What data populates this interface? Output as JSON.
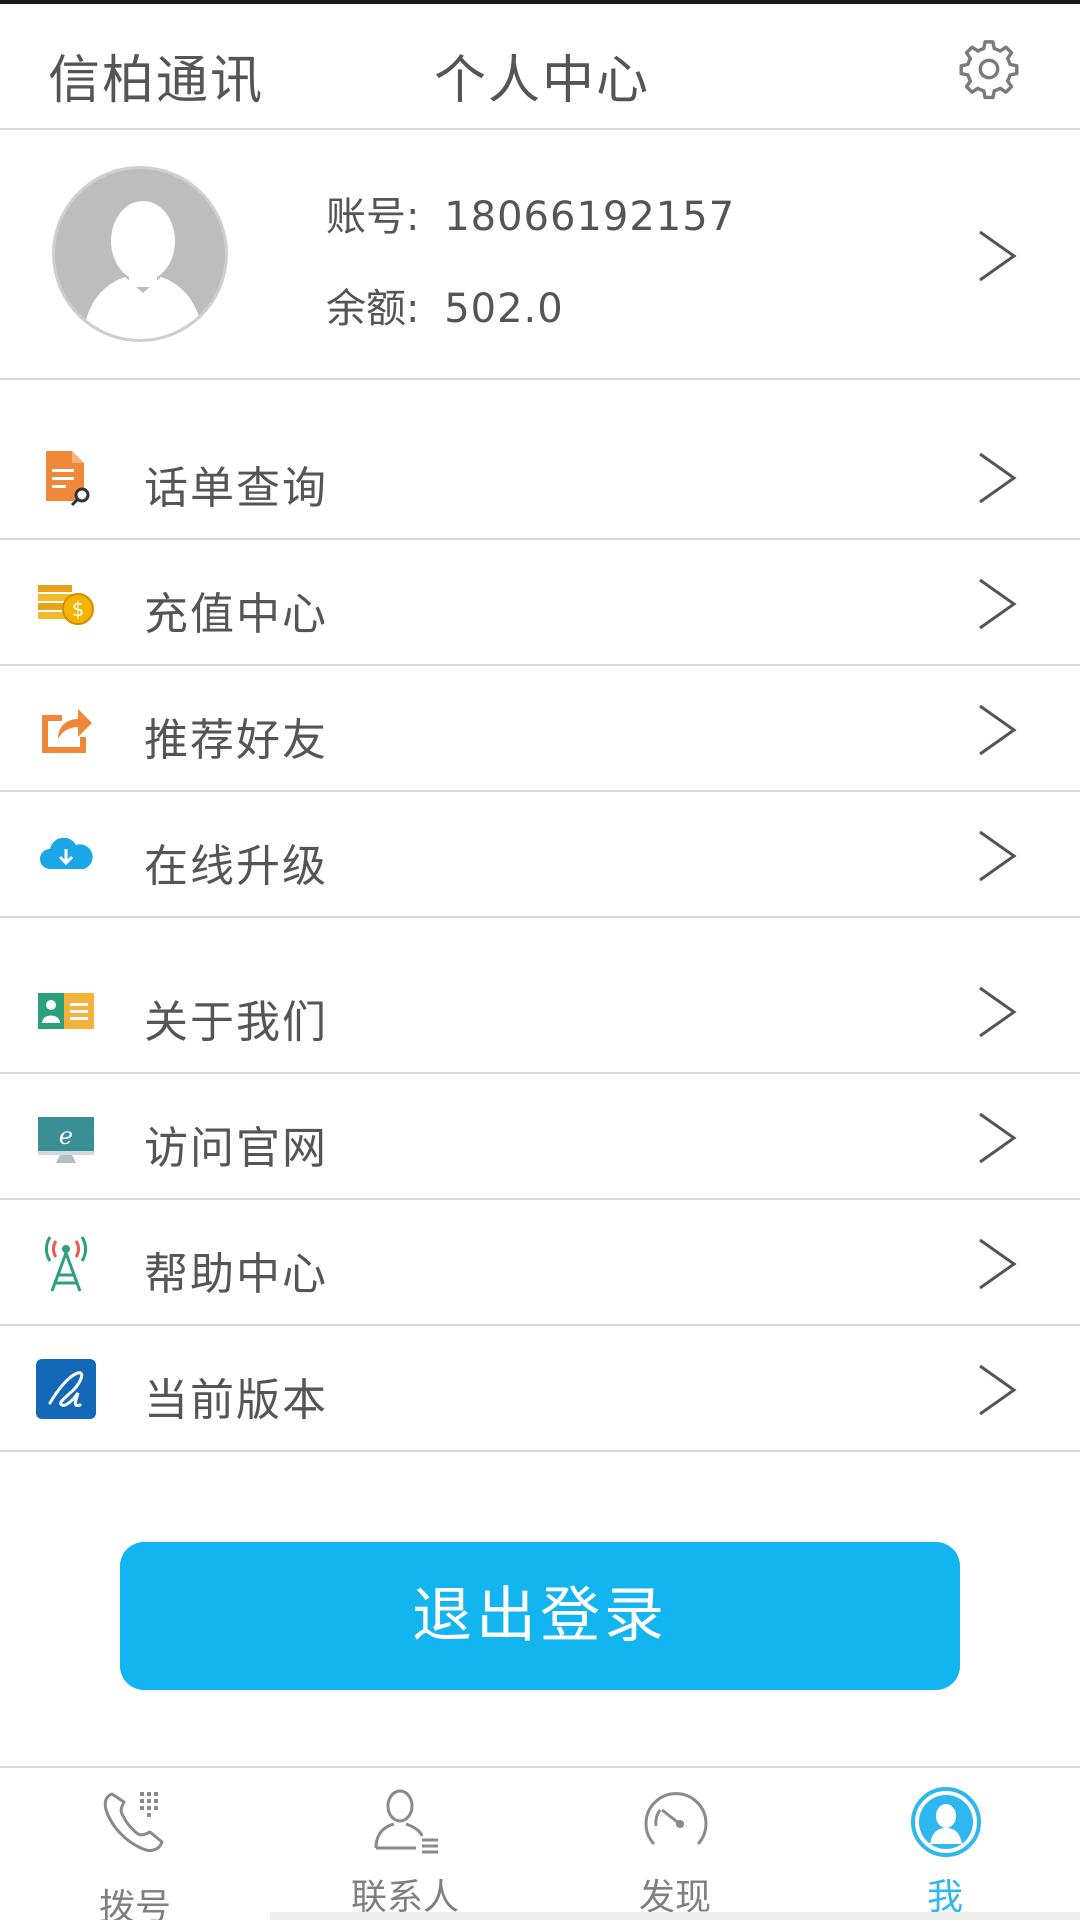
{
  "header": {
    "app_title": "信柏通讯",
    "page_title": "个人中心"
  },
  "profile": {
    "account_label": "账号:",
    "account_value": "18066192157",
    "balance_label": "余额:",
    "balance_value": "502.0"
  },
  "menu": {
    "items": [
      {
        "label": "话单查询",
        "icon": "call-record-search-icon"
      },
      {
        "label": "充值中心",
        "icon": "coins-icon"
      },
      {
        "label": "推荐好友",
        "icon": "share-icon"
      },
      {
        "label": "在线升级",
        "icon": "cloud-download-icon"
      },
      {
        "label": "关于我们",
        "icon": "id-card-icon"
      },
      {
        "label": "访问官网",
        "icon": "browser-icon"
      },
      {
        "label": "帮助中心",
        "icon": "signal-tower-icon"
      },
      {
        "label": "当前版本",
        "icon": "app-logo-icon"
      }
    ]
  },
  "logout_label": "退出登录",
  "tabs": [
    {
      "label": "拨号",
      "icon": "phone-dialpad-icon",
      "active": false
    },
    {
      "label": "联系人",
      "icon": "contact-icon",
      "active": false
    },
    {
      "label": "发现",
      "icon": "discover-icon",
      "active": false
    },
    {
      "label": "我",
      "icon": "me-avatar-icon",
      "active": true
    }
  ],
  "colors": {
    "accent": "#13b5f1",
    "text": "#555555",
    "divider": "#d9d9d9",
    "tab_active": "#2fb8ef"
  }
}
